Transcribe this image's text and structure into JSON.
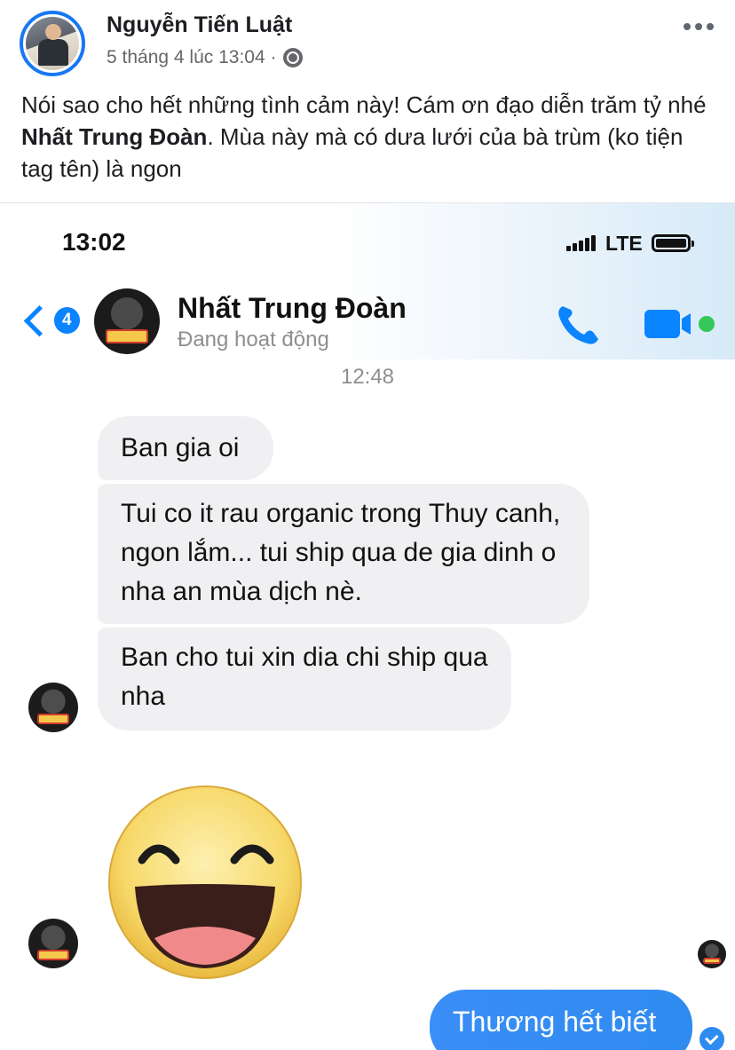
{
  "post": {
    "author_name": "Nguyễn Tiến Luật",
    "timestamp": "5 tháng 4 lúc 13:04 ·",
    "privacy_icon": "globe-icon",
    "more_icon": "more-horizontal-icon",
    "text_part1": "Nói sao cho hết những tình cảm này! Cám ơn đạo diễn trăm tỷ nhé ",
    "text_mention": "Nhất Trung Đoàn",
    "text_part2": ". Mùa này mà có dưa lưới của bà trùm (ko tiện tag tên) là ngon"
  },
  "messenger": {
    "status_time": "13:02",
    "network_label": "LTE",
    "unread_count": "4",
    "contact_name": "Nhất Trung Đoàn",
    "contact_status": "Đang hoạt động",
    "chat_timestamp": "12:48",
    "messages": [
      {
        "from": "contact",
        "text": "Ban gia oi"
      },
      {
        "from": "contact",
        "text": "Tui co it rau organic trong Thuy canh, ngon lắm... tui ship qua de gia dinh o nha an mùa dịch nè."
      },
      {
        "from": "contact",
        "text": "Ban cho tui xin dia chi ship qua nha"
      },
      {
        "from": "contact",
        "sticker": "laughing-emoji"
      },
      {
        "from": "me",
        "text": "Thương hết biết"
      }
    ],
    "colors": {
      "accent": "#0a84ff",
      "sent_bubble": "#2d8cf0",
      "received_bubble": "#f0f0f2",
      "active_dot": "#34c759"
    }
  }
}
